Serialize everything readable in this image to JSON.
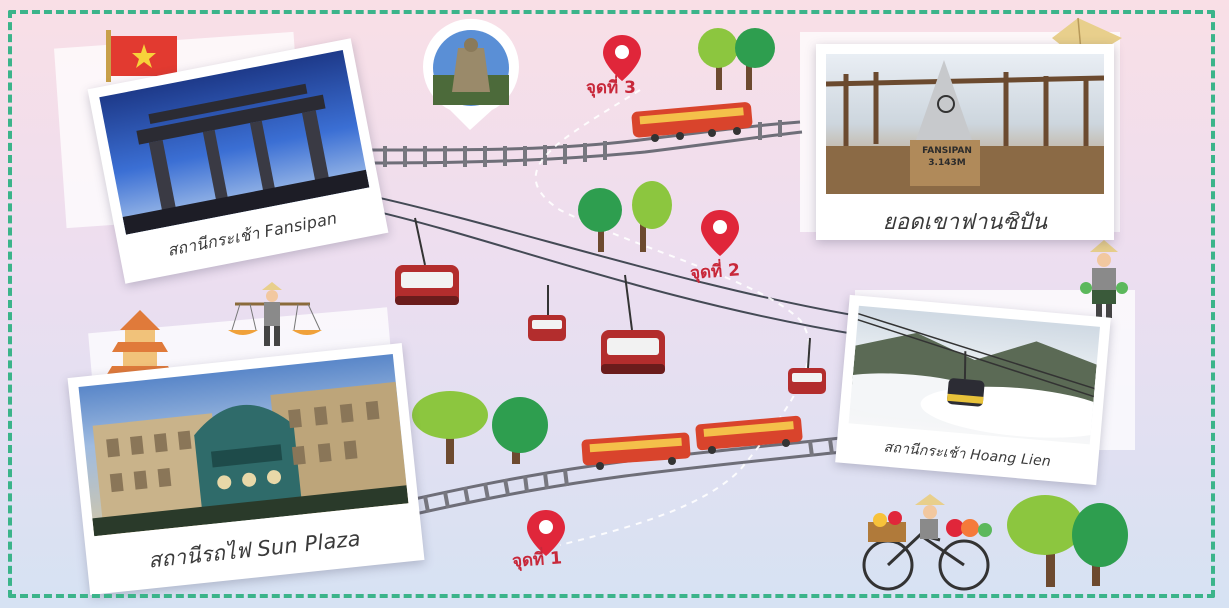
{
  "cards": {
    "fansipan_station": "สถานีกระเช้า Fansipan",
    "summit": "ยอดเขาฟานซิปัน",
    "hoang_lien": "สถานีกระเช้า Hoang Lien",
    "sun_plaza": "สถานีรถไฟ Sun Plaza"
  },
  "summit_marker": {
    "line1": "FANSIPAN",
    "line2": "3.143M"
  },
  "pins": {
    "p1": "จุดที่ 1",
    "p2": "จุดที่ 2",
    "p3": "จุดที่ 3"
  },
  "icons": {
    "flag": "vietnam-flag-icon",
    "pin": "map-pin-icon",
    "gondola": "cable-car-icon",
    "train": "train-icon",
    "tree": "tree-icon",
    "hat": "conical-hat-icon"
  },
  "colors": {
    "border": "#3bb48a",
    "pin": "#e0263a",
    "gondola": "#b32d2d",
    "train": "#d9442c"
  }
}
